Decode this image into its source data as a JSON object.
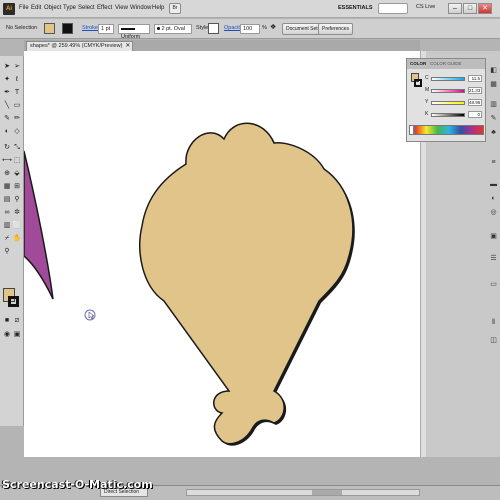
{
  "menubar": {
    "logo": "Ai",
    "items": [
      "File",
      "Edit",
      "Object",
      "Type",
      "Select",
      "Effect",
      "View",
      "Window",
      "Help"
    ],
    "bridge_label": "Br",
    "workspace": "ESSENTIALS",
    "cs_live": "CS Live",
    "window_buttons": [
      "–",
      "□",
      "✕"
    ]
  },
  "controlbar": {
    "selection": "No Selection",
    "stroke_label": "Stroke",
    "stroke_weight": "1 pt",
    "profile": "Uniform",
    "brush": "2 pt. Oval",
    "style_label": "Style",
    "opacity_label": "Opacity",
    "opacity_value": "100",
    "opacity_unit": "%",
    "document_setup": "Document Setup",
    "preferences": "Preferences"
  },
  "document": {
    "tab_title": "shapes* @ 259.49% (CMYK/Preview)",
    "close": "✕"
  },
  "color_panel": {
    "tab_color": "COLOR",
    "tab_guide": "COLOR GUIDE",
    "channels": [
      {
        "label": "C",
        "value": "11.5",
        "gradient": "linear-gradient(to right,#ffffff,#00aeef)"
      },
      {
        "label": "M",
        "value": "21.33",
        "gradient": "linear-gradient(to right,#ffffff,#ec008c)"
      },
      {
        "label": "Y",
        "value": "48.96",
        "gradient": "linear-gradient(to right,#ffffff,#fff200)"
      },
      {
        "label": "K",
        "value": "0",
        "gradient": "linear-gradient(to right,#ffffff,#000000)"
      }
    ]
  },
  "status": {
    "tool": "Direct Selection",
    "watermark": "Screencast-O-Matic.com"
  },
  "colors": {
    "shape_fill": "#e0c48a",
    "shape_stroke": "#1a1a1a",
    "purple_shape": "#a24a9a"
  }
}
